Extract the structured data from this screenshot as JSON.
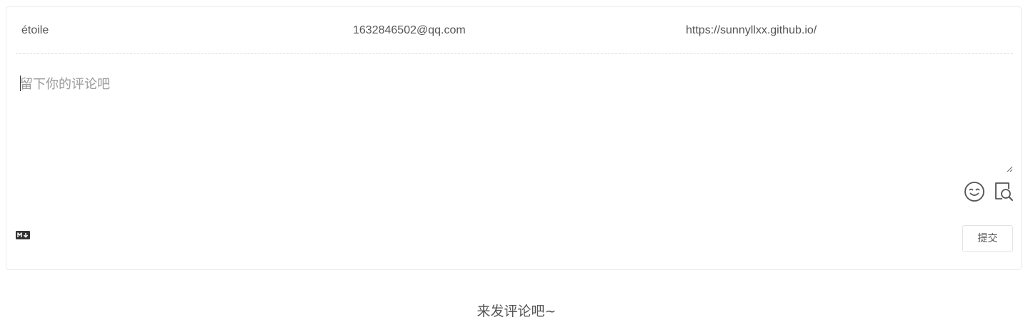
{
  "comment_form": {
    "nickname_value": "étoile",
    "email_value": "1632846502@qq.com",
    "website_value": "https://sunnyllxx.github.io/",
    "textarea_placeholder": "留下你的评论吧",
    "submit_label": "提交",
    "markdown_badge_icon": "markdown-icon",
    "emoji_icon": "emoji-face-icon",
    "preview_icon": "preview-search-icon"
  },
  "comments": {
    "empty_message": "来发评论吧~"
  },
  "colors": {
    "border": "#ececec",
    "text": "#555555",
    "placeholder": "#999999"
  }
}
